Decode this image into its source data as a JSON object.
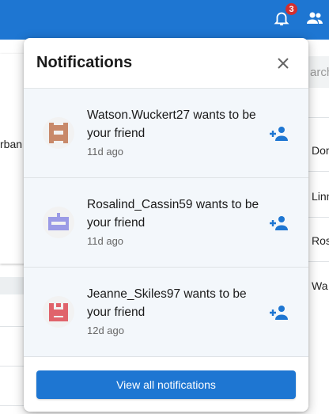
{
  "header": {
    "notification_count": "3",
    "bell_icon": "bell-icon",
    "people_icon": "people-icon"
  },
  "background": {
    "left_text": "rban",
    "search_placeholder": "arch",
    "rows": [
      "Dom",
      "Linn",
      "Ros",
      "Wa"
    ]
  },
  "popup": {
    "title": "Notifications",
    "close_icon": "close-icon",
    "items": [
      {
        "message": "Watson.Wuckert27 wants to be your friend",
        "time": "11d ago",
        "avatar_color": "#c8896a"
      },
      {
        "message": "Rosalind_Cassin59 wants to be your friend",
        "time": "11d ago",
        "avatar_color": "#9b9be6"
      },
      {
        "message": "Jeanne_Skiles97 wants to be your friend",
        "time": "12d ago",
        "avatar_color": "#e0636b"
      }
    ],
    "view_all_label": "View all notifications"
  },
  "colors": {
    "primary": "#1e76d2",
    "badge": "#d32f2f",
    "item_bg": "#f3f7fb"
  }
}
